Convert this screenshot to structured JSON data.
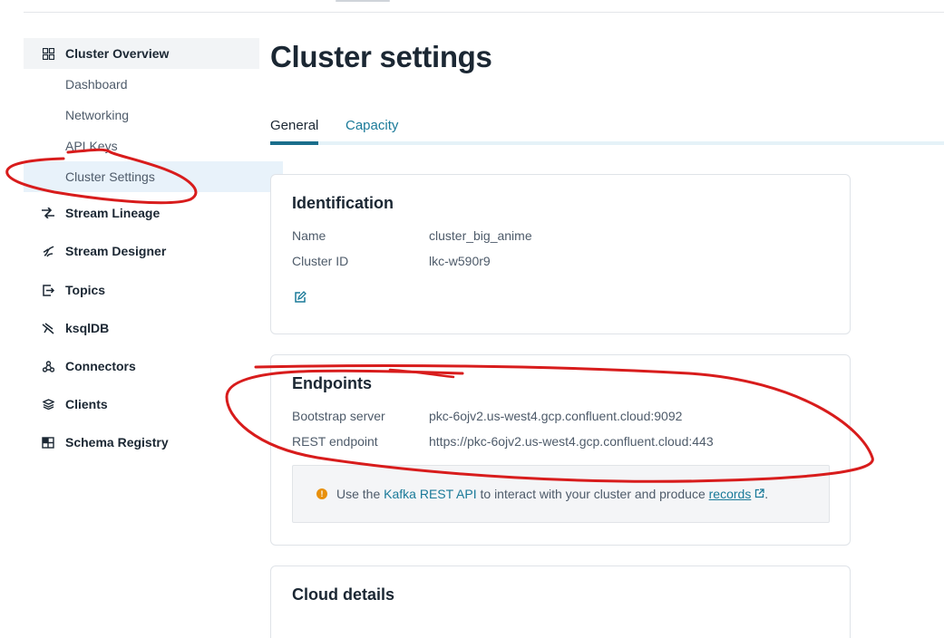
{
  "sidebar": {
    "sections": [
      {
        "label": "Cluster Overview",
        "icon": "grid-icon"
      },
      {
        "label": "Stream Lineage",
        "icon": "lineage-icon"
      },
      {
        "label": "Stream Designer",
        "icon": "designer-icon"
      },
      {
        "label": "Topics",
        "icon": "topics-icon"
      },
      {
        "label": "ksqlDB",
        "icon": "ksqldb-icon"
      },
      {
        "label": "Connectors",
        "icon": "connectors-icon"
      },
      {
        "label": "Clients",
        "icon": "clients-icon"
      },
      {
        "label": "Schema Registry",
        "icon": "schema-registry-icon"
      }
    ],
    "subitems": [
      {
        "label": "Dashboard"
      },
      {
        "label": "Networking"
      },
      {
        "label": "API Keys"
      },
      {
        "label": "Cluster Settings",
        "active": true
      }
    ]
  },
  "main": {
    "title": "Cluster settings",
    "tabs": [
      {
        "label": "General",
        "active": true
      },
      {
        "label": "Capacity",
        "active": false
      }
    ],
    "identification": {
      "title": "Identification",
      "rows": [
        {
          "label": "Name",
          "value": "cluster_big_anime"
        },
        {
          "label": "Cluster ID",
          "value": "lkc-w590r9"
        }
      ]
    },
    "endpoints": {
      "title": "Endpoints",
      "rows": [
        {
          "label": "Bootstrap server",
          "value": "pkc-6ojv2.us-west4.gcp.confluent.cloud:9092"
        },
        {
          "label": "REST endpoint",
          "value": "https://pkc-6ojv2.us-west4.gcp.confluent.cloud:443"
        }
      ],
      "info": {
        "prefix": "Use the",
        "link": "Kafka REST API",
        "middle": "to interact with your cluster and produce",
        "records_link": "records",
        "suffix": "."
      }
    },
    "cloud_details": {
      "title": "Cloud details"
    }
  },
  "colors": {
    "accent": "#1a7a99",
    "annotation": "#d81c1c",
    "warning": "#e8900c"
  }
}
